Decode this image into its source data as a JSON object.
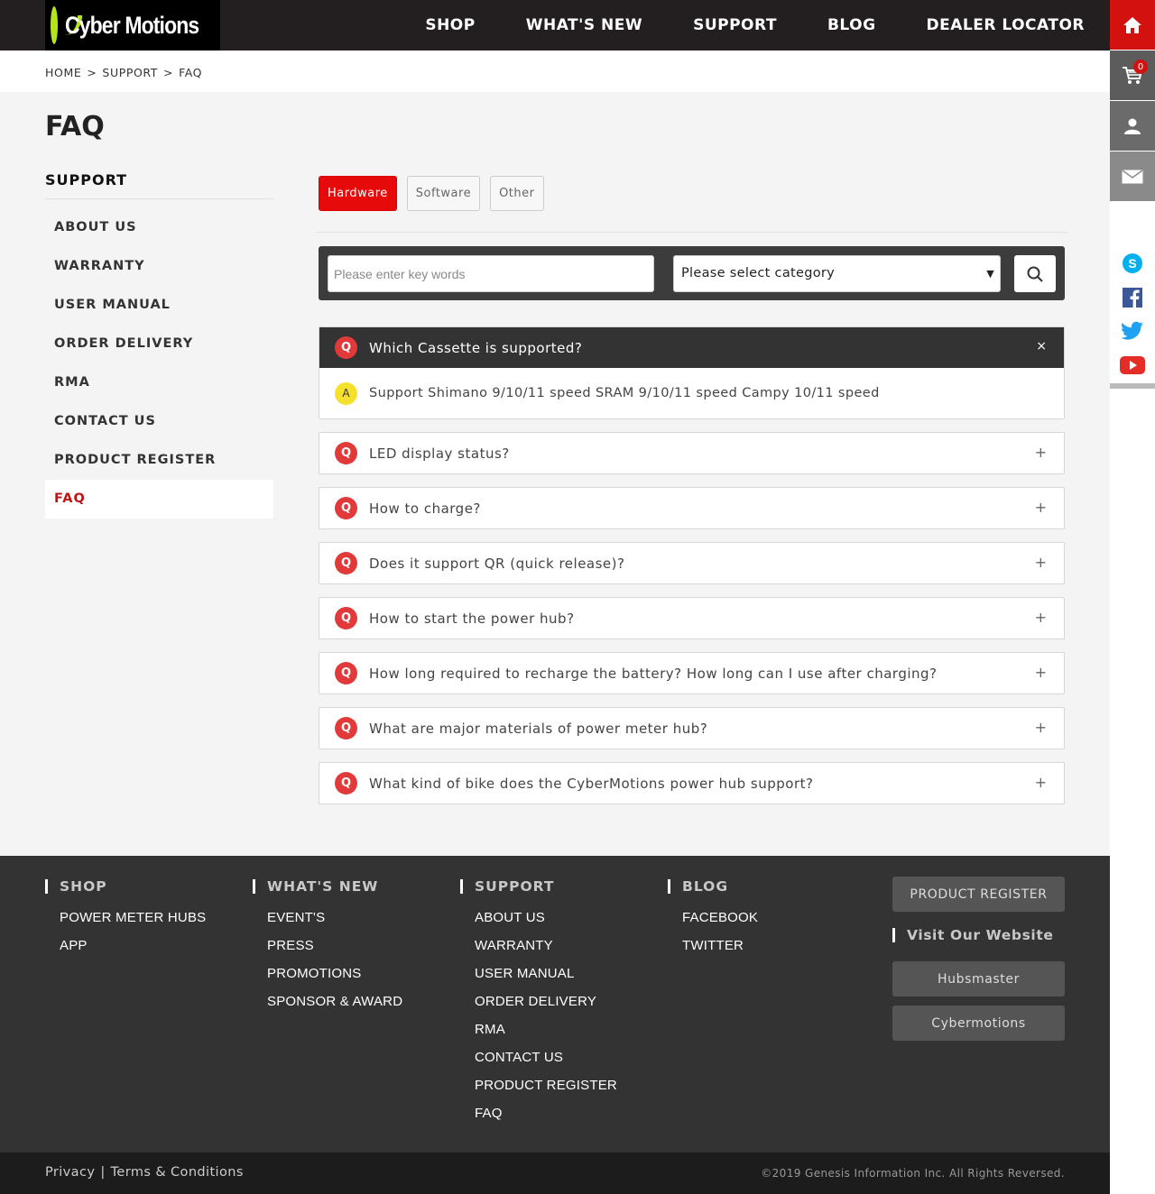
{
  "header": {
    "logo_text": "Cyber Motions",
    "nav": [
      "SHOP",
      "WHAT'S NEW",
      "SUPPORT",
      "BLOG",
      "DEALER LOCATOR"
    ]
  },
  "side_tools": {
    "cart_count": "0"
  },
  "breadcrumb": [
    "HOME",
    ">",
    "SUPPORT",
    ">",
    "FAQ"
  ],
  "page_title": "FAQ",
  "left_nav": {
    "heading": "SUPPORT",
    "items": [
      "ABOUT US",
      "WARRANTY",
      "USER MANUAL",
      "ORDER DELIVERY",
      "RMA",
      "CONTACT US",
      "PRODUCT REGISTER",
      "FAQ"
    ],
    "active": "FAQ"
  },
  "tabs": [
    {
      "label": "Hardware",
      "active": true
    },
    {
      "label": "Software",
      "active": false
    },
    {
      "label": "Other",
      "active": false
    }
  ],
  "search": {
    "placeholder": "Please enter key words",
    "category_selected": "Please select category"
  },
  "faq": {
    "q_badge": "Q",
    "a_badge": "A",
    "open_toggle": "×",
    "closed_toggle": "+",
    "items": [
      {
        "question": "Which Cassette is supported?",
        "answer": "Support Shimano 9/10/11 speed SRAM 9/10/11 speed Campy 10/11 speed",
        "open": true
      },
      {
        "question": "LED display status?",
        "open": false
      },
      {
        "question": "How to charge?",
        "open": false
      },
      {
        "question": "Does it support QR (quick release)?",
        "open": false
      },
      {
        "question": "How to start the power hub?",
        "open": false
      },
      {
        "question": "How long required to recharge the battery? How long can I use after charging?",
        "open": false
      },
      {
        "question": "What are major materials of power meter hub?",
        "open": false
      },
      {
        "question": "What kind of bike does the CyberMotions power hub support?",
        "open": false
      }
    ]
  },
  "footer": {
    "columns": [
      {
        "heading": "SHOP",
        "links": [
          "POWER METER HUBS",
          "APP"
        ]
      },
      {
        "heading": "WHAT'S NEW",
        "links": [
          "EVENT'S",
          "PRESS",
          "PROMOTIONS",
          "SPONSOR & AWARD"
        ]
      },
      {
        "heading": "SUPPORT",
        "links": [
          "ABOUT US",
          "WARRANTY",
          "USER MANUAL",
          "ORDER DELIVERY",
          "RMA",
          "CONTACT US",
          "PRODUCT REGISTER",
          "FAQ"
        ]
      },
      {
        "heading": "BLOG",
        "links": [
          "FACEBOOK",
          "TWITTER"
        ]
      }
    ],
    "product_register_button": "PRODUCT REGISTER",
    "visit_title": "Visit Our Website",
    "visit_buttons": [
      "Hubsmaster",
      "Cybermotions"
    ],
    "legal": {
      "privacy": "Privacy",
      "separator": "|",
      "terms": "Terms & Conditions"
    },
    "copyright": "©2019 Genesis Information Inc. All Rights Reversed."
  },
  "colors": {
    "accent_red": "#e60a0a",
    "dark": "#231f20",
    "answer_badge": "#f5e12b",
    "logo_green": "#b5e61d"
  }
}
